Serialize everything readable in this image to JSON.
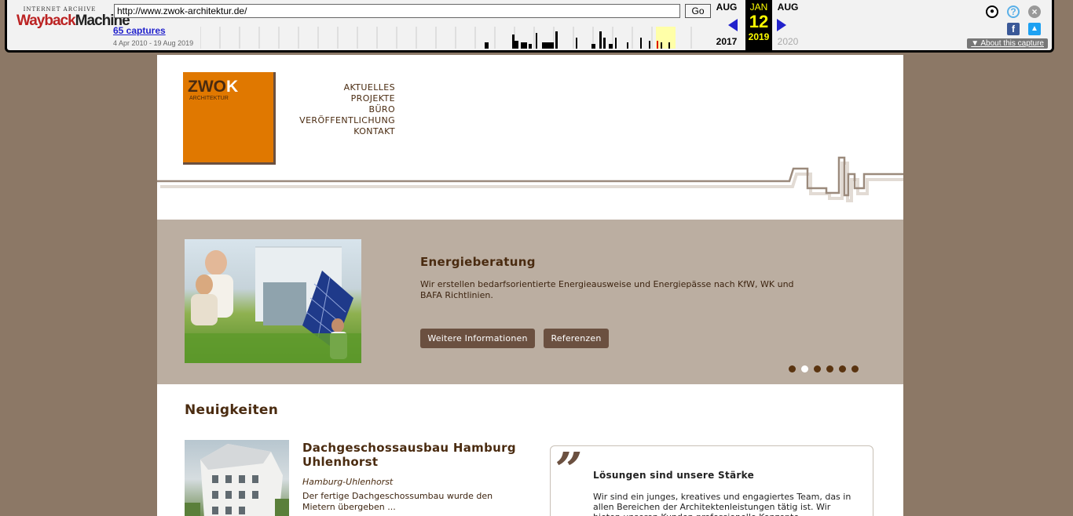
{
  "wayback": {
    "logo_top": "INTERNET ARCHIVE",
    "logo_wayback": "Wayback",
    "logo_machine": "Machine",
    "url": "http://www.zwok-architektur.de/",
    "go_label": "Go",
    "captures": "65 captures",
    "range": "4 Apr 2010 - 19 Aug 2019",
    "prev_month": "AUG",
    "prev_year": "2017",
    "cur_month": "JAN",
    "cur_day": "12",
    "cur_year": "2019",
    "next_month": "AUG",
    "next_year": "2020",
    "about": "About this capture",
    "spark_levels": [
      0,
      0,
      0,
      0,
      0,
      0,
      0,
      0,
      0,
      0,
      0,
      0,
      0,
      0,
      0,
      0,
      0,
      0,
      0,
      0,
      0,
      0,
      0,
      0,
      0,
      0,
      0,
      0,
      0,
      0,
      0,
      0,
      0,
      0,
      0,
      0,
      0,
      0,
      0,
      0,
      0,
      0,
      0,
      0,
      0,
      0,
      0,
      0,
      0,
      0,
      0,
      0,
      0,
      0,
      0,
      0,
      0,
      0,
      0,
      0,
      0,
      0,
      0,
      0,
      0,
      0,
      0,
      0,
      0,
      0,
      0,
      0,
      0,
      0,
      0,
      0,
      0,
      0,
      0,
      0,
      0,
      0,
      0,
      0,
      0,
      0,
      0,
      0,
      0,
      0,
      0,
      0,
      0,
      0,
      0,
      0,
      0,
      0,
      0,
      0,
      0,
      0,
      0,
      0,
      0,
      0,
      0,
      0,
      0,
      0,
      0,
      0,
      0,
      0,
      0,
      0,
      0,
      0,
      0,
      0,
      0,
      0,
      0,
      0,
      0,
      0,
      0,
      0,
      0,
      0,
      0,
      0,
      0,
      0,
      0,
      0,
      0,
      0,
      0,
      0,
      0,
      0,
      0,
      0,
      0,
      0,
      0,
      0,
      0,
      0,
      0,
      0,
      0,
      0,
      0,
      0,
      0,
      0,
      0,
      0,
      0,
      0,
      0,
      0,
      0,
      0,
      0,
      0,
      0,
      0,
      0,
      0,
      0,
      0,
      0,
      0,
      0,
      0,
      0,
      0,
      0,
      0,
      0,
      0,
      0,
      0,
      0,
      0,
      0,
      0,
      0,
      0,
      0,
      0,
      0,
      0,
      0,
      0,
      0,
      0,
      0,
      0,
      0,
      0,
      0,
      0,
      0,
      0,
      0,
      0,
      0,
      0,
      0,
      0,
      0,
      0,
      0,
      0,
      0,
      0,
      0,
      0,
      0,
      0,
      0,
      0,
      0,
      0,
      0,
      0,
      0,
      0,
      0,
      0,
      0,
      0,
      0,
      0,
      0,
      0,
      0,
      0,
      0,
      0,
      0,
      0,
      0,
      0,
      0,
      0,
      0,
      0,
      0,
      0,
      0,
      0,
      0,
      0,
      0,
      0,
      0,
      0,
      0,
      0,
      0,
      0,
      0,
      0,
      0,
      0,
      0,
      0,
      0,
      0,
      0,
      0,
      0,
      0,
      0,
      0,
      0,
      0,
      0,
      0,
      0,
      0,
      0,
      0,
      0,
      0,
      0,
      0,
      0,
      0,
      0,
      0,
      0,
      0,
      0,
      0,
      0,
      0,
      0,
      0,
      0,
      0,
      0,
      0,
      0,
      0,
      0,
      0,
      0,
      0,
      0,
      0,
      0,
      0,
      0,
      0,
      0,
      0,
      0,
      0,
      0,
      0,
      0,
      0,
      0,
      0,
      0,
      0,
      0,
      0,
      0,
      0,
      0,
      0,
      0,
      0,
      0,
      0,
      0,
      0,
      0,
      0,
      0,
      0,
      0,
      0,
      0,
      0,
      0,
      0,
      0,
      0,
      0,
      0,
      0,
      0,
      0,
      0,
      0,
      0,
      0,
      0,
      0,
      0,
      0,
      0,
      0,
      0,
      0,
      0,
      0,
      0,
      0,
      0,
      0,
      0,
      0,
      0,
      0,
      0,
      0,
      0,
      0,
      0,
      0,
      0,
      0,
      0,
      0,
      0,
      0,
      0,
      0,
      0,
      0,
      0,
      0,
      0,
      0,
      0,
      0,
      0,
      0,
      0,
      0,
      0,
      0,
      0,
      0,
      0,
      0,
      0,
      0,
      0,
      0,
      0,
      0,
      0,
      0,
      0,
      0,
      0,
      0,
      0,
      0,
      0,
      0,
      0,
      0,
      0,
      0,
      0,
      0,
      0,
      0,
      0,
      0,
      0,
      0,
      0,
      0,
      0,
      0,
      0,
      0,
      0,
      0,
      0,
      0,
      0,
      0,
      0,
      0,
      0,
      0,
      0,
      0,
      0,
      0,
      0,
      0,
      0,
      0,
      0,
      0,
      0,
      0,
      0,
      0,
      0,
      0,
      0,
      0,
      0,
      0,
      0,
      0,
      0,
      0,
      0,
      0,
      0,
      0,
      0,
      0,
      0,
      0,
      0,
      0,
      0,
      0,
      0,
      0,
      0,
      0,
      0,
      0,
      0,
      0,
      0,
      0,
      0,
      0,
      0,
      0,
      0,
      0,
      0,
      0,
      0,
      0,
      0,
      0,
      0,
      0,
      0,
      0,
      0,
      0,
      0,
      0,
      0,
      0,
      0,
      0,
      0,
      0,
      0,
      0,
      0,
      0,
      0,
      0,
      0,
      0,
      0,
      0,
      0,
      0,
      0,
      0,
      0,
      0,
      0,
      0,
      0,
      0,
      0,
      0,
      0,
      0,
      0,
      0,
      0,
      0,
      0,
      0,
      0,
      0,
      0,
      0,
      0,
      0,
      0,
      0,
      0,
      0,
      0,
      0,
      0,
      0,
      0,
      0,
      0,
      0,
      0,
      0,
      0,
      0,
      0,
      0,
      0,
      0,
      0,
      0,
      0,
      0,
      0,
      0,
      0,
      0,
      0,
      0,
      0,
      0,
      0,
      0,
      0,
      0,
      0,
      0,
      0,
      0,
      0,
      0,
      0,
      0,
      0,
      0,
      0,
      0,
      0,
      0,
      0,
      0,
      0,
      0,
      0,
      0,
      0,
      0,
      0,
      0,
      0,
      0,
      0,
      0,
      0,
      0,
      0,
      0,
      0,
      0,
      0,
      0,
      0,
      0,
      0,
      0,
      0,
      0,
      0,
      0,
      0,
      0,
      0,
      0,
      0,
      0,
      0,
      0,
      0,
      0,
      0,
      0,
      0,
      0,
      0,
      0,
      0,
      0,
      0,
      0,
      0,
      0,
      0,
      0,
      0,
      0,
      0,
      0,
      0,
      0,
      0,
      0,
      0,
      0,
      0,
      0,
      0,
      0,
      0,
      0,
      0,
      0,
      0,
      0,
      0,
      0,
      0,
      0,
      0,
      0,
      0,
      0,
      0,
      0,
      0,
      0,
      0,
      0,
      0,
      0,
      0,
      0,
      0,
      0,
      0,
      0,
      0,
      0,
      0,
      0,
      0,
      0,
      0,
      0,
      0,
      0,
      0,
      0,
      0,
      0,
      0,
      0,
      0,
      0,
      0,
      0,
      0,
      0,
      0,
      0,
      0,
      0,
      0,
      0,
      0,
      0,
      0
    ]
  },
  "site": {
    "logo_main": "ZWO",
    "logo_k": "K",
    "logo_sub": "ARCHITEKTUR",
    "nav": [
      "AKTUELLES",
      "PROJEKTE",
      "BÜRO",
      "VERÖFFENTLICHUNG",
      "KONTAKT"
    ],
    "hero": {
      "title": "Energieberatung",
      "text": "Wir erstellen bedarfsorientierte Energieausweise und Energiepässe nach KfW, WK und BAFA Richtlinien.",
      "btn_more": "Weitere Informationen",
      "btn_refs": "Referenzen",
      "slides": 6,
      "active_slide": 2
    },
    "news": {
      "heading": "Neuigkeiten",
      "title": "Dachgeschossausbau Hamburg Uhlenhorst",
      "location": "Hamburg-Uhlenhorst",
      "text": "Der fertige Dachgeschossumbau wurde den Mietern übergeben ..."
    },
    "quote": {
      "mark": "”",
      "title": "Lösungen sind unsere Stärke",
      "text": "Wir sind ein junges, kreatives und engagiertes Team, das in allen Bereichen der Architektenleistungen tätig ist. Wir bieten unseren Kunden professionelle Konzepte"
    },
    "colors": {
      "brown": "#4a2b10",
      "orange": "#e07800",
      "hero_bg": "#bbaea1",
      "outer_bg": "#8c7866"
    }
  }
}
